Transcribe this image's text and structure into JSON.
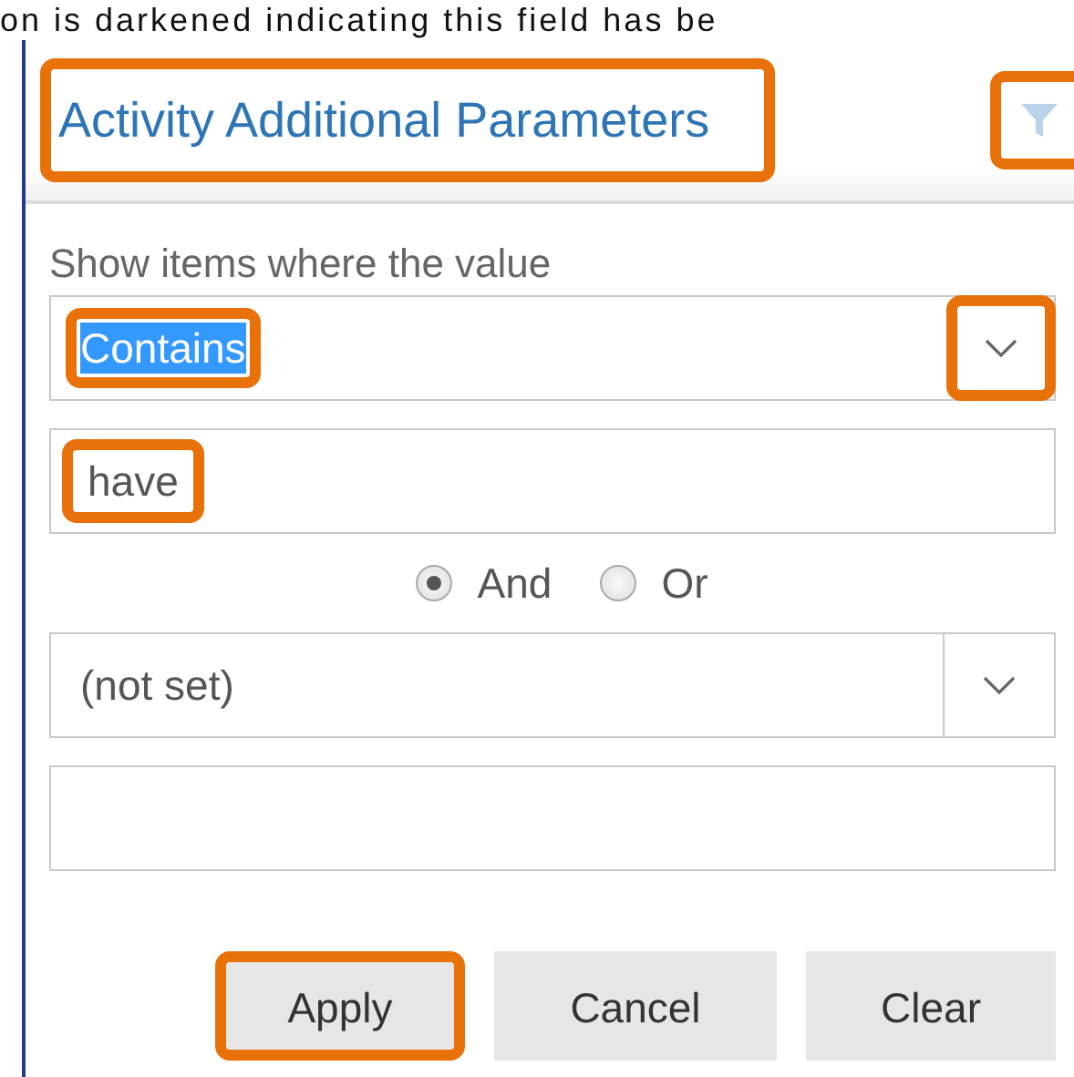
{
  "caption": "on is darkened indicating this field has be",
  "header": {
    "title": "Activity Additional Parameters",
    "title_highlighted": true,
    "filter_icon_highlighted": true
  },
  "prompt": "Show items where the value",
  "first_condition": {
    "operator": {
      "value": "Contains",
      "value_selected": true,
      "value_highlighted": true,
      "chevron_highlighted": true,
      "split_button": false
    },
    "value": {
      "value": "have",
      "highlighted": true
    }
  },
  "joins": [
    {
      "label": "And",
      "selected": true
    },
    {
      "label": "Or",
      "selected": false
    }
  ],
  "second_condition": {
    "operator": {
      "value": "(not set)",
      "value_selected": false,
      "value_highlighted": false,
      "chevron_highlighted": false,
      "split_button": true
    },
    "value": {
      "highlighted": false
    }
  },
  "buttons": [
    {
      "label": "Apply",
      "highlighted": true
    },
    {
      "label": "Cancel",
      "highlighted": false
    },
    {
      "label": "Clear",
      "highlighted": false
    }
  ]
}
